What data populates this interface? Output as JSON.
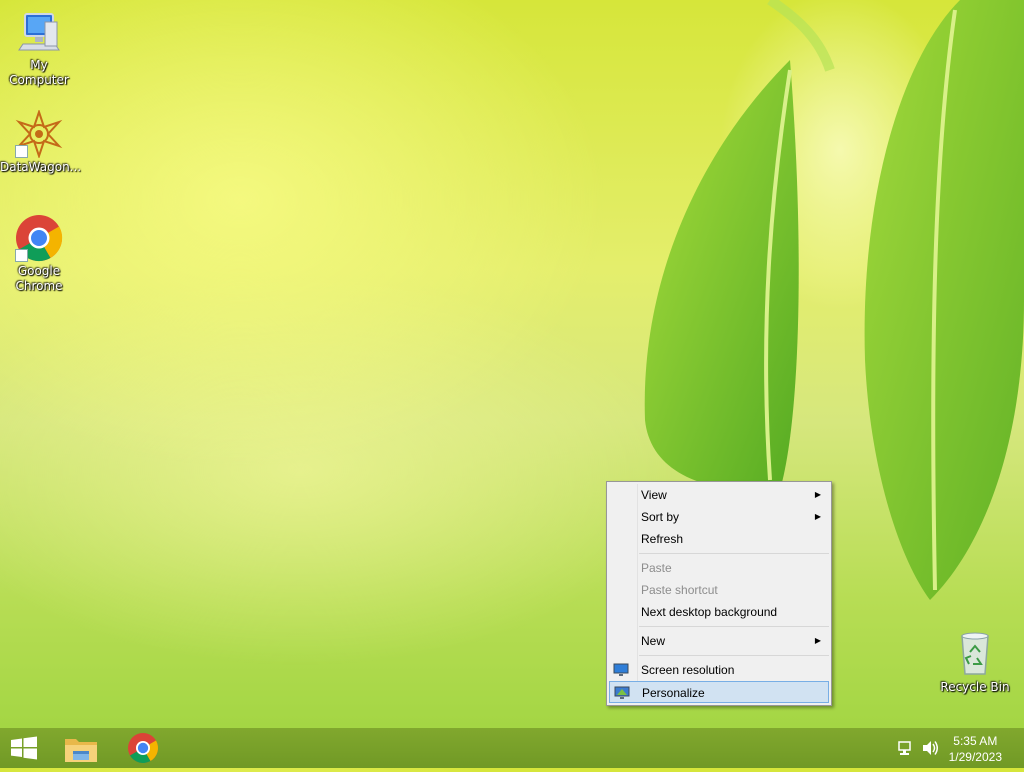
{
  "desktop": {
    "icons": [
      {
        "label": "My Computer",
        "icon": "computer-icon"
      },
      {
        "label": "DataWagon...",
        "icon": "datawagon-icon"
      },
      {
        "label": "Google Chrome",
        "icon": "chrome-icon"
      },
      {
        "label": "Recycle Bin",
        "icon": "recycle-bin-icon"
      }
    ]
  },
  "context_menu": {
    "items": [
      {
        "label": "View",
        "submenu": true
      },
      {
        "label": "Sort by",
        "submenu": true
      },
      {
        "label": "Refresh"
      },
      {
        "label": "Paste",
        "disabled": true
      },
      {
        "label": "Paste shortcut",
        "disabled": true
      },
      {
        "label": "Next desktop background"
      },
      {
        "label": "New",
        "submenu": true
      },
      {
        "label": "Screen resolution",
        "icon": "monitor-icon"
      },
      {
        "label": "Personalize",
        "icon": "personalize-icon",
        "highlighted": true
      }
    ],
    "submenu_arrow": "▶"
  },
  "taskbar": {
    "pinned": [
      "start-icon",
      "file-explorer-icon",
      "chrome-icon"
    ],
    "tray": [
      "network-icon",
      "volume-icon"
    ],
    "clock": {
      "time": "5:35 AM",
      "date": "1/29/2023"
    }
  },
  "colors": {
    "taskbar": "#7aa22c",
    "menu_highlight": "#d1e2f2",
    "menu_highlight_border": "#78aee5"
  }
}
